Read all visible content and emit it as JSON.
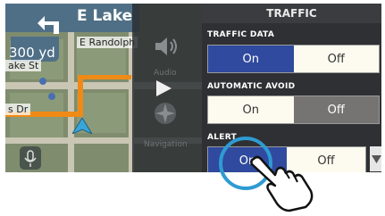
{
  "map": {
    "street_name": "E Lake",
    "distance": "300 yd",
    "labels": [
      "E Randolph",
      "ake St",
      "s Dr"
    ]
  },
  "side_panel": {
    "items": [
      {
        "label": "Audio",
        "icon": "speaker-icon"
      },
      {
        "label": "",
        "icon": "play-icon"
      },
      {
        "label": "Navigation",
        "icon": "compass-icon"
      }
    ]
  },
  "settings": {
    "title": "TRAFFIC",
    "sections": [
      {
        "label": "TRAFFIC DATA",
        "on": "On",
        "off": "Off",
        "selected": "on"
      },
      {
        "label": "AUTOMATIC AVOID",
        "on": "On",
        "off": "Off",
        "selected": "off"
      },
      {
        "label": "ALERT",
        "on": "On",
        "off": "Off",
        "selected": "on"
      }
    ]
  },
  "colors": {
    "selected_on": "#2f4a9e",
    "selected_off": "#767472",
    "unselected": "#fdfbef",
    "touch_ring": "#2e9bd3",
    "route": "#f08a16"
  }
}
